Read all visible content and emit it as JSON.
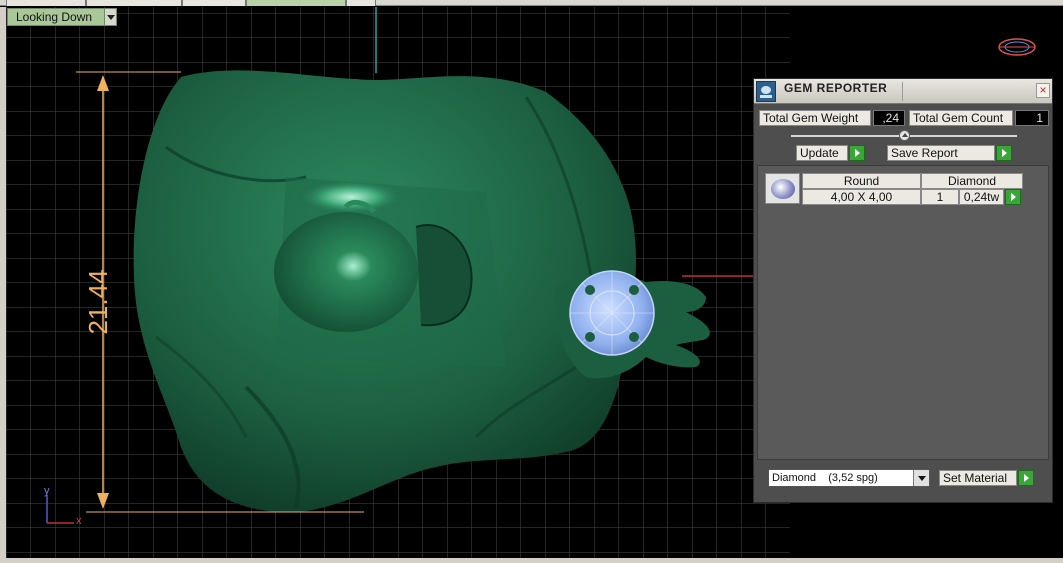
{
  "viewport": {
    "view_label": "Looking Down",
    "dimension_label": "21.44",
    "axis_y_label": "y",
    "axis_x_label": "x"
  },
  "gem_reporter": {
    "title": "GEM REPORTER",
    "close_symbol": "×",
    "total_weight_label": "Total Gem Weight",
    "total_weight_value": ",24",
    "total_count_label": "Total Gem Count",
    "total_count_value": "1",
    "update_label": "Update",
    "save_report_label": "Save Report",
    "gem_row": {
      "shape": "Round",
      "size": "4,00 X 4,00",
      "material": "Diamond",
      "count": "1",
      "weight": "0,24tw"
    },
    "material_select_value": "Diamond    (3,52 spg)",
    "set_material_label": "Set Material"
  },
  "colors": {
    "model_green": "#1c5e40",
    "gem_blue": "#8fb0ee",
    "grid_line": "#4a4a4a",
    "dimension_orange": "#f0b060",
    "panel_bg": "#4e4e4e"
  }
}
